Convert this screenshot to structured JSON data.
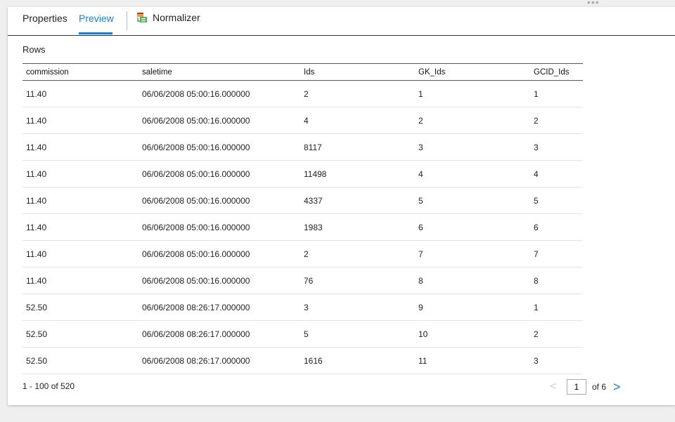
{
  "tabs": {
    "properties": "Properties",
    "preview": "Preview"
  },
  "object": {
    "name": "Normalizer",
    "icon": "normalizer-transformation-icon"
  },
  "section_title": "Rows",
  "columns": [
    "commission",
    "saletime",
    "Ids",
    "GK_Ids",
    "GCID_Ids"
  ],
  "rows": [
    [
      "11.40",
      "06/06/2008 05:00:16.000000",
      "2",
      "1",
      "1"
    ],
    [
      "11.40",
      "06/06/2008 05:00:16.000000",
      "4",
      "2",
      "2"
    ],
    [
      "11.40",
      "06/06/2008 05:00:16.000000",
      "8117",
      "3",
      "3"
    ],
    [
      "11.40",
      "06/06/2008 05:00:16.000000",
      "11498",
      "4",
      "4"
    ],
    [
      "11.40",
      "06/06/2008 05:00:16.000000",
      "4337",
      "5",
      "5"
    ],
    [
      "11.40",
      "06/06/2008 05:00:16.000000",
      "1983",
      "6",
      "6"
    ],
    [
      "11.40",
      "06/06/2008 05:00:16.000000",
      "2",
      "7",
      "7"
    ],
    [
      "11.40",
      "06/06/2008 05:00:16.000000",
      "76",
      "8",
      "8"
    ],
    [
      "52.50",
      "06/06/2008 08:26:17.000000",
      "3",
      "9",
      "1"
    ],
    [
      "52.50",
      "06/06/2008 08:26:17.000000",
      "5",
      "10",
      "2"
    ],
    [
      "52.50",
      "06/06/2008 08:26:17.000000",
      "1616",
      "11",
      "3"
    ]
  ],
  "pagination": {
    "range": "1 - 100  of  520",
    "current_page": "1",
    "of_total": "of 6",
    "prev_symbol": "<",
    "next_symbol": ">"
  },
  "more_symbol": "•••",
  "accent_color": "#1a7fd4"
}
